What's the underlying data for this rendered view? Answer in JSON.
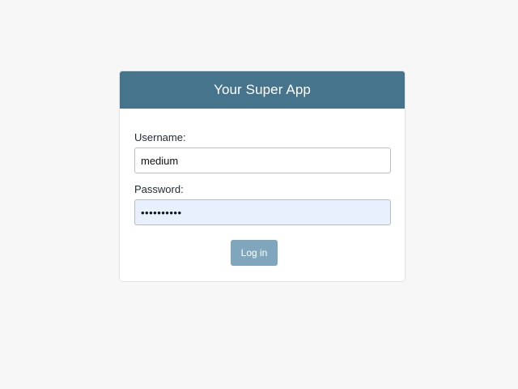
{
  "app": {
    "title": "Your Super App"
  },
  "form": {
    "username_label": "Username:",
    "username_value": "medium",
    "password_label": "Password:",
    "password_value": "••••••••••",
    "login_label": "Log in"
  },
  "colors": {
    "header_bg": "#46748d",
    "button_bg": "#7fa6bd",
    "password_field_bg": "#e8f0fe",
    "page_bg": "#f7f7f7"
  }
}
